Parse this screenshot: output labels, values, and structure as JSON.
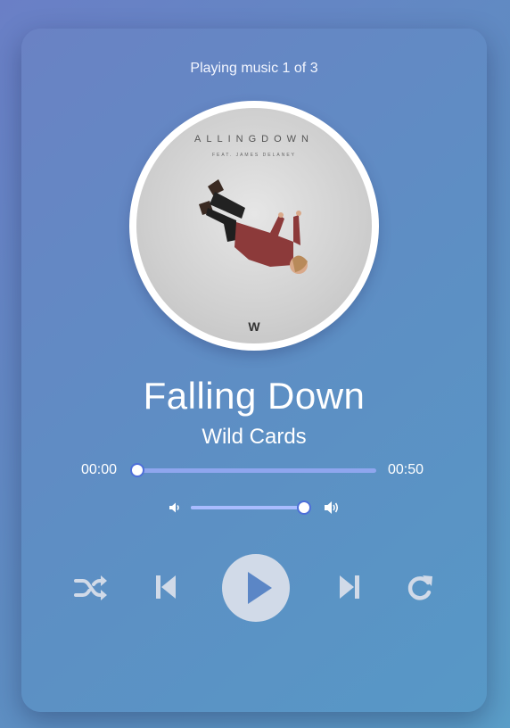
{
  "status_text": "Playing music 1 of 3",
  "album_cover": {
    "cover_text_top": "ALLINGDOWN",
    "cover_text_sub": "FEAT. JAMES DELANEY",
    "cover_logo": "W"
  },
  "track": {
    "title": "Falling Down",
    "artist": "Wild Cards"
  },
  "progress": {
    "current_time": "00:00",
    "duration": "00:50",
    "fraction": 0.0
  },
  "volume": {
    "fraction": 0.98,
    "low_icon": "volume-low-icon",
    "high_icon": "volume-high-icon"
  },
  "controls": {
    "shuffle_icon": "shuffle-icon",
    "prev_icon": "previous-track-icon",
    "play_icon": "play-icon",
    "next_icon": "next-track-icon",
    "repeat_icon": "repeat-icon"
  },
  "colors": {
    "accent": "#4d6fd9",
    "track": "#8fa6ee",
    "control_icons": "#d1dae8"
  }
}
